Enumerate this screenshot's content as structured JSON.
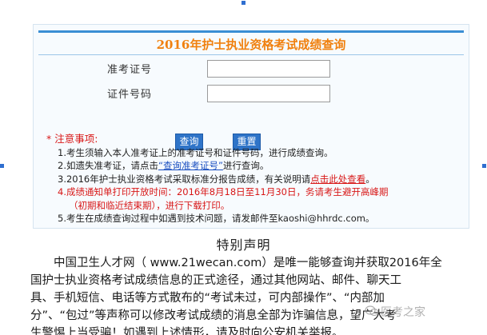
{
  "panel": {
    "title": "2016年护士执业资格考试成绩查询",
    "fields": [
      {
        "label": "准考证号",
        "value": ""
      },
      {
        "label": "证件号码",
        "value": ""
      }
    ],
    "buttons": {
      "query": "查询",
      "reset": "重置"
    }
  },
  "notes": {
    "title": "注意事项:",
    "star": "*",
    "n1": "1.考生须输入本人准考证上的准考证号和证件号码，进行成绩查询。",
    "n2_pre": "2.如遗失准考证，请点击",
    "n2_link": "“查询准考证号”",
    "n2_post": "进行查询。",
    "n3_pre": "3.2016年护士执业资格考试采取标准分报告成绩，有关说明请",
    "n3_link": "点击此处查看",
    "n3_post": "。",
    "n4_line1": "4.成绩通知单打印开放时间：2016年8月18日至11月30日，务请考生避开高峰期",
    "n4_line2": "（初期和临近结束期），进行下载打印。",
    "n5": "5.考生在成绩查询过程中如遇到技术问题，请发邮件至kaoshi@hhrdc.com。"
  },
  "statement": {
    "heading": "特别声明",
    "lines": [
      "　　中国卫生人才网（ www.21wecan.com）是唯一能够查询并获取2016年全",
      "国护士执业资格考试成绩信息的正式途径，通过其他网站、邮件、聊天工",
      "具、手机短信、电话等方式散布的“考试未过，可内部操作”、“内部加",
      "分”、“包过”等声称可以修改考试成绩的消息全部为诈骗信息，望广大考",
      "生警惕上当受骗！如遇到上述情形，请及时向公安机关举报。"
    ]
  },
  "watermark": "医考之家",
  "colors": {
    "title": "#f0800e",
    "button": "#2f74c8",
    "warning": "#d81818",
    "link": "#1a4fc0"
  }
}
